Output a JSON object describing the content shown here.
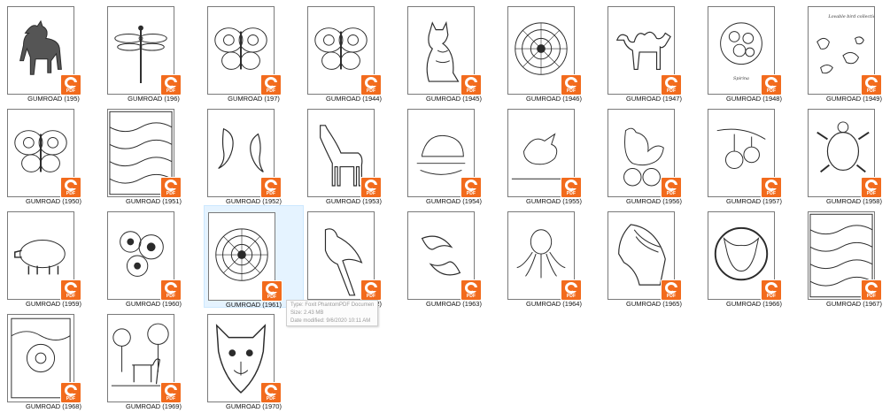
{
  "files": [
    {
      "label": "GUMROAD (195)",
      "art": "horse-icon"
    },
    {
      "label": "GUMROAD (196)",
      "art": "dragonfly-icon"
    },
    {
      "label": "GUMROAD (197)",
      "art": "butterfly-icon"
    },
    {
      "label": "GUMROAD (1944)",
      "art": "butterfly-icon"
    },
    {
      "label": "GUMROAD (1945)",
      "art": "cat-icon"
    },
    {
      "label": "GUMROAD (1946)",
      "art": "mandala-icon"
    },
    {
      "label": "GUMROAD (1947)",
      "art": "camel-icon"
    },
    {
      "label": "GUMROAD (1948)",
      "art": "flower-circle-icon"
    },
    {
      "label": "GUMROAD (1949)",
      "art": "birds-icon"
    },
    {
      "label": "GUMROAD (1950)",
      "art": "butterfly-icon"
    },
    {
      "label": "GUMROAD (1951)",
      "art": "pattern-icon"
    },
    {
      "label": "GUMROAD (1952)",
      "art": "koi-fish-icon"
    },
    {
      "label": "GUMROAD (1953)",
      "art": "giraffe-icon"
    },
    {
      "label": "GUMROAD (1954)",
      "art": "hedgehog-icon"
    },
    {
      "label": "GUMROAD (1955)",
      "art": "bird-scene-icon"
    },
    {
      "label": "GUMROAD (1956)",
      "art": "rooster-icon"
    },
    {
      "label": "GUMROAD (1957)",
      "art": "fruit-branch-icon"
    },
    {
      "label": "GUMROAD (1958)",
      "art": "turtle-icon"
    },
    {
      "label": "GUMROAD (1959)",
      "art": "pig-icon"
    },
    {
      "label": "GUMROAD (1960)",
      "art": "flowers-icon"
    },
    {
      "label": "GUMROAD (1961)",
      "art": "mandala-icon"
    },
    {
      "label": "GUMROAD (1962)",
      "art": "parrot-icon"
    },
    {
      "label": "GUMROAD (1963)",
      "art": "dolphins-icon"
    },
    {
      "label": "GUMROAD (1964)",
      "art": "octopus-icon"
    },
    {
      "label": "GUMROAD (1965)",
      "art": "horse-head-icon"
    },
    {
      "label": "GUMROAD (1966)",
      "art": "bull-circle-icon"
    },
    {
      "label": "GUMROAD (1967)",
      "art": "pattern-icon"
    },
    {
      "label": "GUMROAD (1968)",
      "art": "flower-frame-icon"
    },
    {
      "label": "GUMROAD (1969)",
      "art": "horse-trees-icon"
    },
    {
      "label": "GUMROAD (1970)",
      "art": "wolf-icon"
    }
  ],
  "selected_index": 20,
  "badge": {
    "text": "PDF",
    "color": "#f26b1d"
  },
  "tooltip": {
    "type": "Type: Foxit PhantomPDF Document",
    "size": "Size: 2.43 MB",
    "modified": "Date modified: 9/6/2020 10:11 AM"
  },
  "inner_texts": {
    "flower_circle": "Spirina",
    "birds_title": "Lovable bird collection"
  }
}
